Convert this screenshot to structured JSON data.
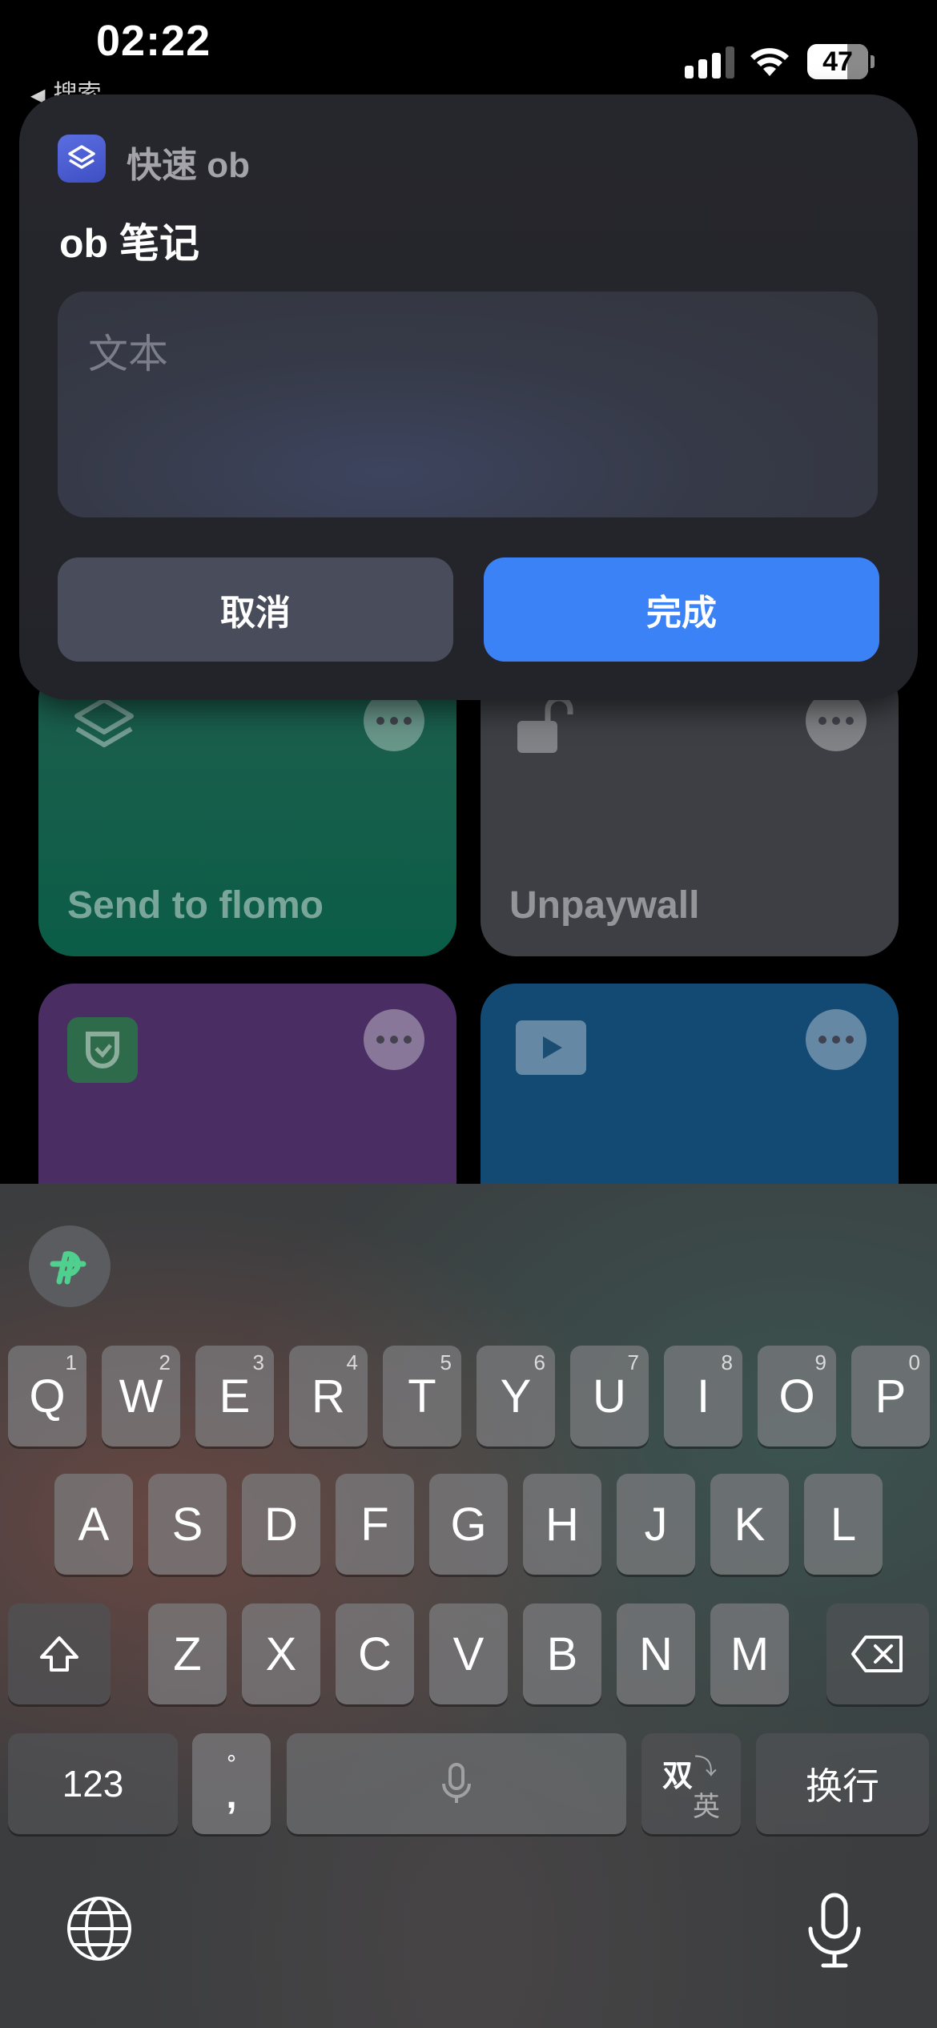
{
  "status_bar": {
    "time": "02:22",
    "back_label": "搜索",
    "battery_level": "47"
  },
  "background_tiles": [
    {
      "label": "Send to flomo",
      "color": "#0f5a45",
      "icon": "stack-icon"
    },
    {
      "label": "Unpaywall",
      "color": "#3d3f44",
      "icon": "unlock-icon"
    },
    {
      "label": "",
      "color": "#4a2e63",
      "icon": "mijia-icon"
    },
    {
      "label": "",
      "color": "#134a74",
      "icon": "play-icon"
    }
  ],
  "dialog": {
    "app_name": "快速 ob",
    "title": "ob 笔记",
    "input": {
      "placeholder": "文本",
      "value": ""
    },
    "cancel_label": "取消",
    "done_label": "完成",
    "done_color": "#3b82f6"
  },
  "keyboard": {
    "row1": [
      {
        "k": "Q",
        "n": "1"
      },
      {
        "k": "W",
        "n": "2"
      },
      {
        "k": "E",
        "n": "3"
      },
      {
        "k": "R",
        "n": "4"
      },
      {
        "k": "T",
        "n": "5"
      },
      {
        "k": "Y",
        "n": "6"
      },
      {
        "k": "U",
        "n": "7"
      },
      {
        "k": "I",
        "n": "8"
      },
      {
        "k": "O",
        "n": "9"
      },
      {
        "k": "P",
        "n": "0"
      }
    ],
    "row2": [
      "A",
      "S",
      "D",
      "F",
      "G",
      "H",
      "J",
      "K",
      "L"
    ],
    "row3": [
      "Z",
      "X",
      "C",
      "V",
      "B",
      "N",
      "M"
    ],
    "numbers_label": "123",
    "punct_top": "°",
    "punct_bottom": ",",
    "lang_top": "双",
    "lang_bottom": "英",
    "return_label": "换行"
  }
}
